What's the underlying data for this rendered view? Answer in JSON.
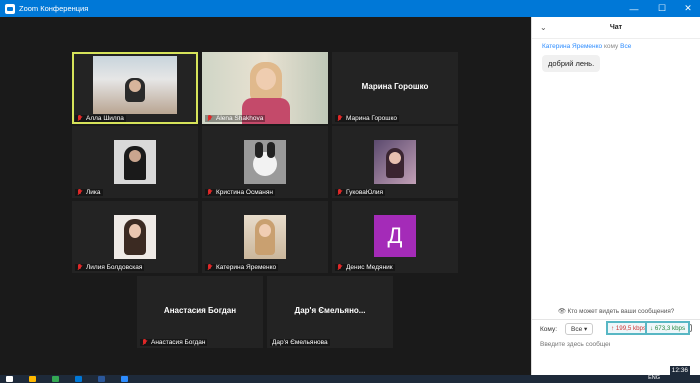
{
  "window": {
    "title": "Zoom Конференция"
  },
  "controls": {
    "minimize": "—",
    "maximize": "☐",
    "close": "✕"
  },
  "participants": [
    {
      "name": "Алла Шилпа",
      "muted": true,
      "active": true,
      "video": true
    },
    {
      "name": "Alena Shakhova",
      "muted": true,
      "video": true
    },
    {
      "name": "Марина Горошко",
      "muted": true,
      "video": false
    },
    {
      "name": "Лика",
      "muted": true,
      "video": true
    },
    {
      "name": "Кристина Османян",
      "muted": true,
      "video": true
    },
    {
      "name": "ГуковаЮлия",
      "muted": true,
      "video": true
    },
    {
      "name": "Лилия Болдовская",
      "muted": true,
      "video": true
    },
    {
      "name": "Катерина Яременко",
      "muted": true,
      "video": true
    },
    {
      "name": "Денис Медяник",
      "muted": true,
      "avatar_letter": "Д",
      "avatar_color": "#a42bb8"
    },
    {
      "name": "Анастасия Богдан",
      "muted": true,
      "video": false
    },
    {
      "name": "Дар'я Ємельянова",
      "muted": false,
      "video": false,
      "big_name": "Дар'я Ємельяно..."
    }
  ],
  "chat": {
    "title": "Чат",
    "message": {
      "from": "Катерина Яременко",
      "to_prefix": "кому",
      "to": "Все",
      "text": "добрий лень."
    },
    "privacy": "Кто может видеть ваши сообщения?",
    "to_label": "Кому:",
    "to_value": "Все",
    "input_placeholder": "Введите здесь сообщение..."
  },
  "network": {
    "up": "↑ 199,5 kbps",
    "down": "↓ 673,3 kbps"
  },
  "taskbar": {
    "lang": "ENG",
    "time": "12:36"
  },
  "colors": {
    "title_bar": "#0078d7",
    "active_speaker": "#d6e35a",
    "accent": "#2d8cff"
  }
}
